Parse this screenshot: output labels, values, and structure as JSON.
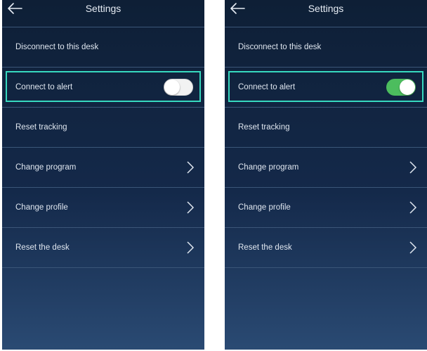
{
  "screens": [
    {
      "title": "Settings",
      "items": [
        {
          "label": "Disconnect to this desk"
        },
        {
          "label": "Connect to alert",
          "toggle": "off"
        },
        {
          "label": "Reset tracking"
        },
        {
          "label": "Change program",
          "icon": "chevron-right-icon"
        },
        {
          "label": "Change profile",
          "icon": "chevron-right-icon"
        },
        {
          "label": "Reset the desk",
          "icon": "chevron-right-icon"
        }
      ]
    },
    {
      "title": "Settings",
      "items": [
        {
          "label": "Disconnect to this desk"
        },
        {
          "label": "Connect to alert",
          "toggle": "on"
        },
        {
          "label": "Reset tracking"
        },
        {
          "label": "Change program",
          "icon": "chevron-right-icon"
        },
        {
          "label": "Change profile",
          "icon": "chevron-right-icon"
        },
        {
          "label": "Reset the desk",
          "icon": "chevron-right-icon"
        }
      ]
    }
  ],
  "colors": {
    "background_top": "#0e1f36",
    "background_bottom": "#2a4a73",
    "highlight": "#37d9bf",
    "toggle_on": "#4cbd5e",
    "toggle_off": "#f2f2f2"
  }
}
